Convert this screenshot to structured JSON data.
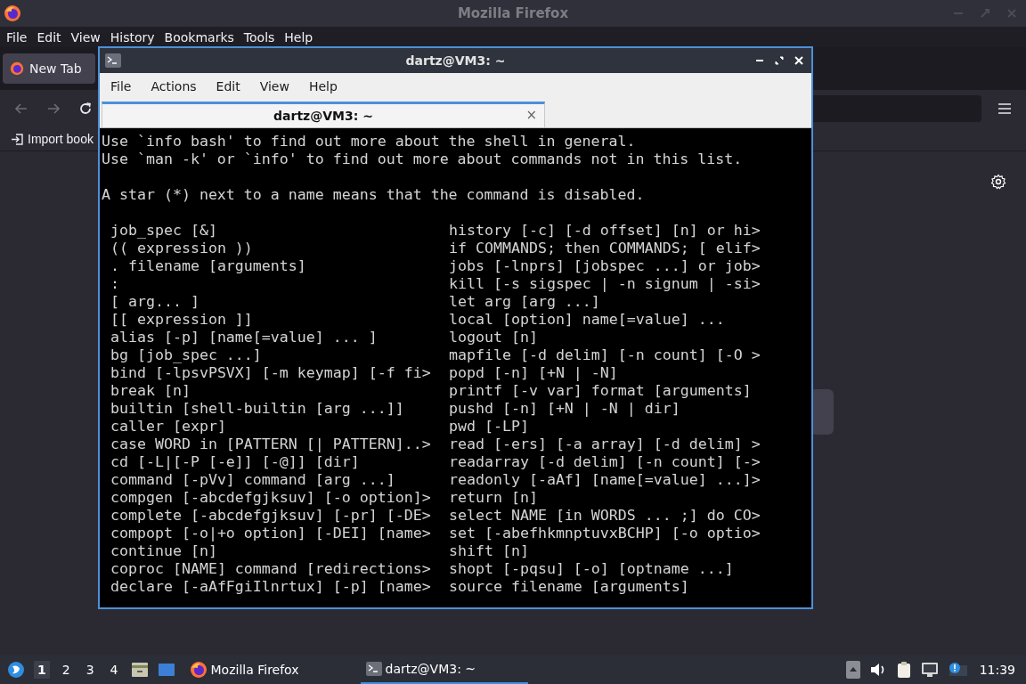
{
  "firefox": {
    "title": "Mozilla Firefox",
    "menu": [
      "File",
      "Edit",
      "View",
      "History",
      "Bookmarks",
      "Tools",
      "Help"
    ],
    "tabs": [
      {
        "label": "New Tab",
        "selected": true
      }
    ],
    "bookmarks": [
      "Import book"
    ]
  },
  "terminal": {
    "title": "dartz@VM3: ~",
    "menu": [
      "File",
      "Actions",
      "Edit",
      "View",
      "Help"
    ],
    "tabs": [
      {
        "label": "dartz@VM3: ~",
        "close": "×",
        "selected": true
      }
    ],
    "intro": [
      "Use `info bash' to find out more about the shell in general.",
      "Use `man -k' or `info' to find out more about commands not in this list."
    ],
    "note": "A star (*) next to a name means that the command is disabled.",
    "builtins": [
      {
        "left": "job_spec [&]",
        "right": "history [-c] [-d offset] [n] or hi>"
      },
      {
        "left": "(( expression ))",
        "right": "if COMMANDS; then COMMANDS; [ elif>"
      },
      {
        "left": ". filename [arguments]",
        "right": "jobs [-lnprs] [jobspec ...] or job>"
      },
      {
        "left": ":",
        "right": "kill [-s sigspec | -n signum | -si>"
      },
      {
        "left": "[ arg... ]",
        "right": "let arg [arg ...]"
      },
      {
        "left": "[[ expression ]]",
        "right": "local [option] name[=value] ..."
      },
      {
        "left": "alias [-p] [name[=value] ... ]",
        "right": "logout [n]"
      },
      {
        "left": "bg [job_spec ...]",
        "right": "mapfile [-d delim] [-n count] [-O >"
      },
      {
        "left": "bind [-lpsvPSVX] [-m keymap] [-f fi>",
        "right": "popd [-n] [+N | -N]"
      },
      {
        "left": "break [n]",
        "right": "printf [-v var] format [arguments]"
      },
      {
        "left": "builtin [shell-builtin [arg ...]]",
        "right": "pushd [-n] [+N | -N | dir]"
      },
      {
        "left": "caller [expr]",
        "right": "pwd [-LP]"
      },
      {
        "left": "case WORD in [PATTERN [| PATTERN]..>",
        "right": "read [-ers] [-a array] [-d delim] >"
      },
      {
        "left": "cd [-L|[-P [-e]] [-@]] [dir]",
        "right": "readarray [-d delim] [-n count] [->"
      },
      {
        "left": "command [-pVv] command [arg ...]",
        "right": "readonly [-aAf] [name[=value] ...]>"
      },
      {
        "left": "compgen [-abcdefgjksuv] [-o option]>",
        "right": "return [n]"
      },
      {
        "left": "complete [-abcdefgjksuv] [-pr] [-DE>",
        "right": "select NAME [in WORDS ... ;] do CO>"
      },
      {
        "left": "compopt [-o|+o option] [-DEI] [name>",
        "right": "set [-abefhkmnptuvxBCHP] [-o optio>"
      },
      {
        "left": "continue [n]",
        "right": "shift [n]"
      },
      {
        "left": "coproc [NAME] command [redirections>",
        "right": "shopt [-pqsu] [-o] [optname ...]"
      },
      {
        "left": "declare [-aAfFgiIlnrtux] [-p] [name>",
        "right": "source filename [arguments]"
      }
    ]
  },
  "taskbar": {
    "workspaces": [
      {
        "label": "1",
        "selected": true
      },
      {
        "label": "2",
        "selected": false
      },
      {
        "label": "3",
        "selected": false
      },
      {
        "label": "4",
        "selected": false
      }
    ],
    "tasks": [
      {
        "kind": "firefox",
        "label": "Mozilla Firefox",
        "selected": false
      },
      {
        "kind": "terminal",
        "label": "dartz@VM3: ~",
        "selected": true
      }
    ],
    "clock": "11:39"
  }
}
